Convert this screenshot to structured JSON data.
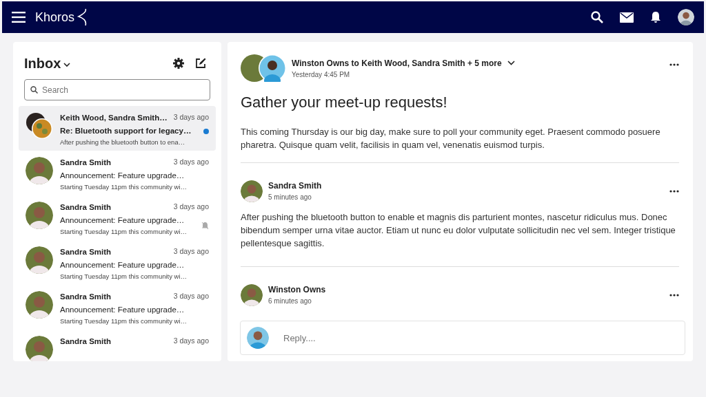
{
  "navbar": {
    "brand": "Khoros"
  },
  "inbox": {
    "title": "Inbox",
    "search": {
      "placeholder": "Search"
    },
    "items": [
      {
        "from": "Keith Wood, Sandra Smith…",
        "time": "3 days ago",
        "subject": "Re: Bluetooth support for legacy…",
        "preview": "After pushing the bluetooth button to ena…",
        "selected": true,
        "unread": true,
        "muted": false,
        "group": true
      },
      {
        "from": "Sandra Smith",
        "time": "3 days ago",
        "subject": "Announcement: Feature upgrade…",
        "preview": "Starting Tuesday 11pm this community wi…",
        "selected": false,
        "unread": false,
        "muted": false,
        "group": false
      },
      {
        "from": "Sandra Smith",
        "time": "3 days ago",
        "subject": "Announcement: Feature upgrade…",
        "preview": "Starting Tuesday 11pm this community wi…",
        "selected": false,
        "unread": false,
        "muted": true,
        "group": false
      },
      {
        "from": "Sandra Smith",
        "time": "3 days ago",
        "subject": "Announcement: Feature upgrade…",
        "preview": "Starting Tuesday 11pm this community wi…",
        "selected": false,
        "unread": false,
        "muted": false,
        "group": false
      },
      {
        "from": "Sandra Smith",
        "time": "3 days ago",
        "subject": "Announcement: Feature upgrade…",
        "preview": "Starting Tuesday 11pm this community wi…",
        "selected": false,
        "unread": false,
        "muted": false,
        "group": false
      },
      {
        "from": "Sandra Smith",
        "time": "3 days ago",
        "selected": false,
        "unread": false,
        "muted": false,
        "group": false
      }
    ]
  },
  "thread": {
    "participants": "Winston Owns to Keith Wood, Sandra Smith + 5 more",
    "time": "Yesterday 4:45 PM",
    "title": "Gather your meet-up requests!",
    "body": "This coming Thursday is our big day, make sure to poll your community eget. Praesent commodo posuere pharetra. Quisque quam velit, facilisis in quam vel, venenatis euismod turpis.",
    "replies": [
      {
        "author": "Sandra Smith",
        "time": "5 minutes ago",
        "body": "After pushing the bluetooth button to enable et magnis dis parturient montes, nascetur ridiculus mus. Donec bibendum semper urna vitae auctor. Etiam ut nunc eu dolor vulputate sollicitudin nec vel sem. Integer tristique pellentesque sagittis."
      },
      {
        "author": "Winston Owns",
        "time": "6 minutes ago"
      }
    ],
    "reply_box": {
      "placeholder": "Reply...."
    }
  }
}
